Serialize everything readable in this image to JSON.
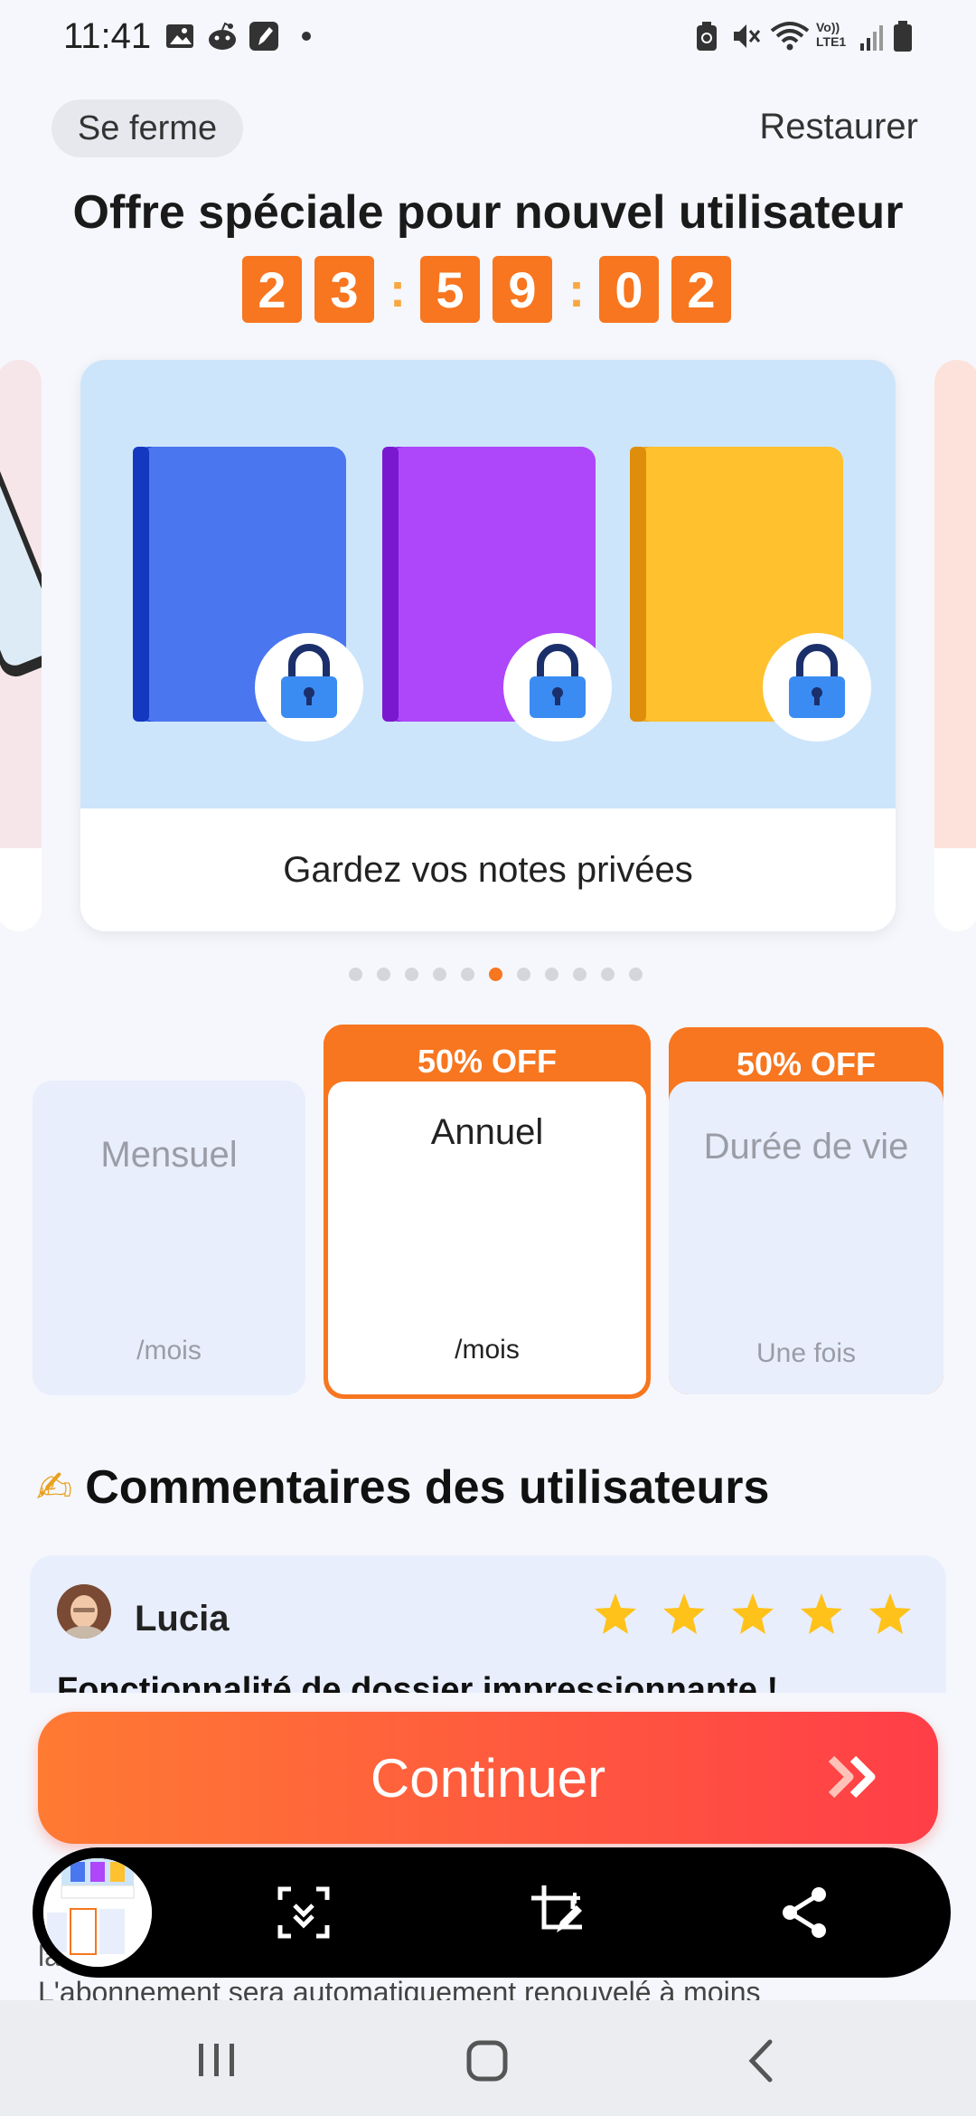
{
  "status_bar": {
    "time": "11:41",
    "left_icons": [
      "image-icon",
      "reddit-icon",
      "note-icon",
      "dot-icon"
    ],
    "right_icons": [
      "battery-saver-icon",
      "mute-icon",
      "wifi-icon",
      "volte-icon",
      "signal-icon",
      "battery-icon"
    ],
    "volte_label": "Vo))\nLTE1"
  },
  "header": {
    "close_label": "Se ferme",
    "restore_label": "Restaurer"
  },
  "offer": {
    "title": "Offre spéciale pour nouvel utilisateur",
    "countdown": [
      "2",
      "3",
      "5",
      "9",
      "0",
      "2"
    ]
  },
  "carousel": {
    "caption": "Gardez vos notes privées",
    "page_count": 11,
    "active_index": 5
  },
  "plans": [
    {
      "name": "Mensuel",
      "sub": "/mois",
      "badge": "",
      "selected": false
    },
    {
      "name": "Annuel",
      "sub": "/mois",
      "badge": "50% OFF",
      "selected": true
    },
    {
      "name": "Durée de vie",
      "sub": "Une fois",
      "badge": "50% OFF",
      "selected": false
    }
  ],
  "reviews": {
    "title": "Commentaires des utilisateurs",
    "emoji": "✍",
    "items": [
      {
        "name": "Lucia",
        "stars": 5,
        "title": "Fonctionnalité de dossier impressionnante !"
      }
    ]
  },
  "cta": {
    "continue_label": "Continuer"
  },
  "legal": {
    "line1": "la",
    "line2": "L'abonnement sera automatiquement renouvelé à moins"
  },
  "colors": {
    "accent": "#F7761F",
    "cta_start": "#FF7A33",
    "cta_end": "#FF3E48",
    "star": "#FFC21A"
  }
}
